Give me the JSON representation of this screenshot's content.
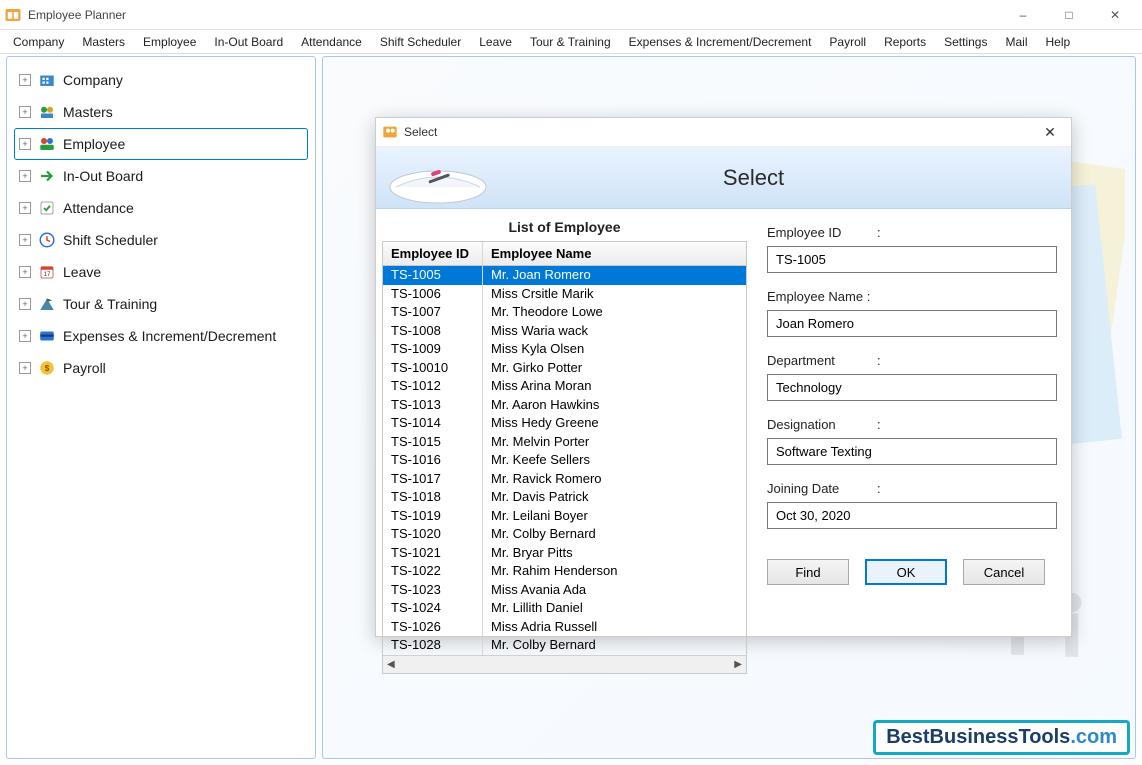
{
  "window": {
    "title": "Employee Planner"
  },
  "menu": [
    "Company",
    "Masters",
    "Employee",
    "In-Out Board",
    "Attendance",
    "Shift Scheduler",
    "Leave",
    "Tour & Training",
    "Expenses & Increment/Decrement",
    "Payroll",
    "Reports",
    "Settings",
    "Mail",
    "Help"
  ],
  "tree": [
    {
      "label": "Company",
      "icon": "company",
      "selected": false
    },
    {
      "label": "Masters",
      "icon": "masters",
      "selected": false
    },
    {
      "label": "Employee",
      "icon": "employee",
      "selected": true
    },
    {
      "label": "In-Out Board",
      "icon": "inout",
      "selected": false
    },
    {
      "label": "Attendance",
      "icon": "attendance",
      "selected": false
    },
    {
      "label": "Shift Scheduler",
      "icon": "shift",
      "selected": false
    },
    {
      "label": "Leave",
      "icon": "leave",
      "selected": false
    },
    {
      "label": "Tour & Training",
      "icon": "tour",
      "selected": false
    },
    {
      "label": "Expenses & Increment/Decrement",
      "icon": "expenses",
      "selected": false
    },
    {
      "label": "Payroll",
      "icon": "payroll",
      "selected": false
    }
  ],
  "dialog": {
    "title": "Select",
    "banner_title": "Select",
    "list_caption": "List of Employee",
    "columns": {
      "id": "Employee ID",
      "name": "Employee Name"
    },
    "rows": [
      {
        "id": "TS-1005",
        "name": "Mr. Joan Romero",
        "selected": true
      },
      {
        "id": "TS-1006",
        "name": "Miss Crsitle Marik"
      },
      {
        "id": "TS-1007",
        "name": "Mr. Theodore Lowe"
      },
      {
        "id": "TS-1008",
        "name": "Miss Waria wack"
      },
      {
        "id": "TS-1009",
        "name": "Miss Kyla Olsen"
      },
      {
        "id": "TS-10010",
        "name": "Mr. Girko Potter"
      },
      {
        "id": "TS-1012",
        "name": "Miss Arina Moran"
      },
      {
        "id": "TS-1013",
        "name": "Mr. Aaron Hawkins"
      },
      {
        "id": "TS-1014",
        "name": "Miss Hedy Greene"
      },
      {
        "id": "TS-1015",
        "name": "Mr. Melvin Porter"
      },
      {
        "id": "TS-1016",
        "name": "Mr. Keefe Sellers"
      },
      {
        "id": "TS-1017",
        "name": "Mr. Ravick Romero"
      },
      {
        "id": "TS-1018",
        "name": "Mr. Davis Patrick"
      },
      {
        "id": "TS-1019",
        "name": "Mr. Leilani Boyer"
      },
      {
        "id": "TS-1020",
        "name": "Mr. Colby Bernard"
      },
      {
        "id": "TS-1021",
        "name": "Mr. Bryar Pitts"
      },
      {
        "id": "TS-1022",
        "name": "Mr. Rahim Henderson"
      },
      {
        "id": "TS-1023",
        "name": "Miss Avania Ada"
      },
      {
        "id": "TS-1024",
        "name": "Mr. Lillith Daniel"
      },
      {
        "id": "TS-1026",
        "name": "Miss Adria Russell"
      },
      {
        "id": "TS-1028",
        "name": "Mr. Colby Bernard"
      }
    ],
    "form": {
      "labels": {
        "emp_id": "Employee ID",
        "emp_name": "Employee Name :",
        "department": "Department",
        "designation": "Designation",
        "joining": "Joining Date"
      },
      "values": {
        "emp_id": "TS-1005",
        "emp_name": "Joan Romero",
        "department": "Technology",
        "designation": "Software Texting",
        "joining": "Oct 30, 2020"
      }
    },
    "buttons": {
      "find": "Find",
      "ok": "OK",
      "cancel": "Cancel"
    }
  },
  "watermark": {
    "main": "BestBusinessTools",
    "suffix": ".com"
  }
}
